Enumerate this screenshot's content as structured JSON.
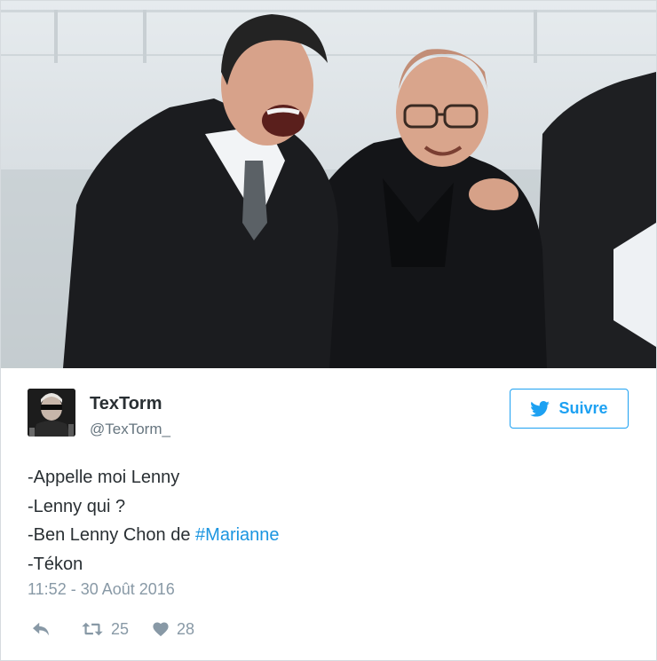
{
  "tweet": {
    "display_name": "TexTorm",
    "handle": "@TexTorm_",
    "follow_label": "Suivre",
    "lines": {
      "line1": "-Appelle moi Lenny",
      "line2": "-Lenny qui ?",
      "line3_prefix": "-Ben Lenny Chon de ",
      "line3_hashtag": "#Marianne",
      "line4": "-Tékon"
    },
    "timestamp": "11:52 - 30 Août 2016",
    "retweets": "25",
    "likes": "28"
  },
  "colors": {
    "accent": "#1da1f2",
    "hashtag": "#1b95e0",
    "muted": "#8899a6",
    "text": "#292f33"
  },
  "icons": {
    "reply": "reply-icon",
    "retweet": "retweet-icon",
    "like": "heart-icon",
    "follow": "twitter-bird-icon"
  }
}
